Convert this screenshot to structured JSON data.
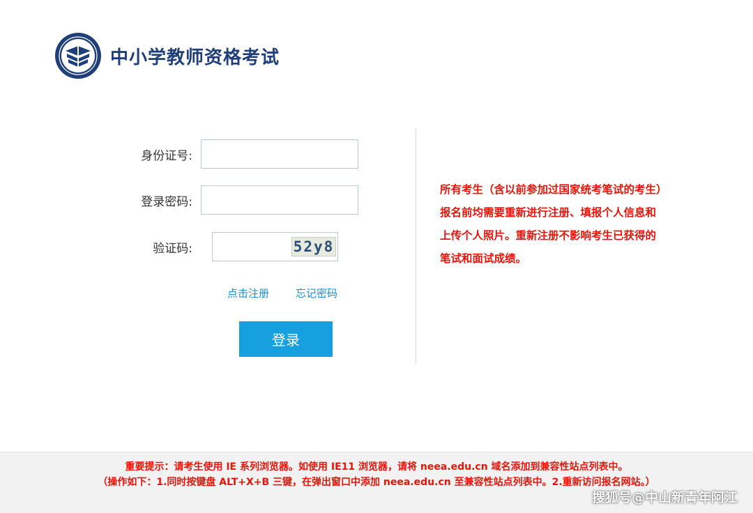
{
  "header": {
    "site_title": "中小学教师资格考试"
  },
  "form": {
    "id_label": "身份证号:",
    "id_value": "",
    "password_label": "登录密码:",
    "password_value": "",
    "captcha_label": "验证码:",
    "captcha_value": "",
    "captcha_code": "52y8",
    "register_link": "点击注册",
    "forgot_link": "忘记密码",
    "login_button": "登录"
  },
  "notice": {
    "text": "所有考生（含以前参加过国家统考笔试的考生）报名前均需要重新进行注册、填报个人信息和上传个人照片。重新注册不影响考生已获得的笔试和面试成绩。"
  },
  "footer": {
    "line1": "重要提示：请考生使用 IE 系列浏览器。如使用 IE11 浏览器，请将 neea.edu.cn 域名添加到兼容性站点列表中。",
    "line2": "（操作如下：1.同时按键盘 ALT+X+B 三键，在弹出窗口中添加 neea.edu.cn 至兼容性站点列表中。2.重新访问报名网站。）"
  },
  "watermark": {
    "text": "搜狐号@中山新青年阿江"
  },
  "colors": {
    "brand_blue": "#1f3f7a",
    "button_blue": "#16a0e0",
    "link_blue": "#1a8fd6",
    "notice_red": "#e8140a"
  },
  "icons": {
    "logo": "book-emblem-icon"
  }
}
